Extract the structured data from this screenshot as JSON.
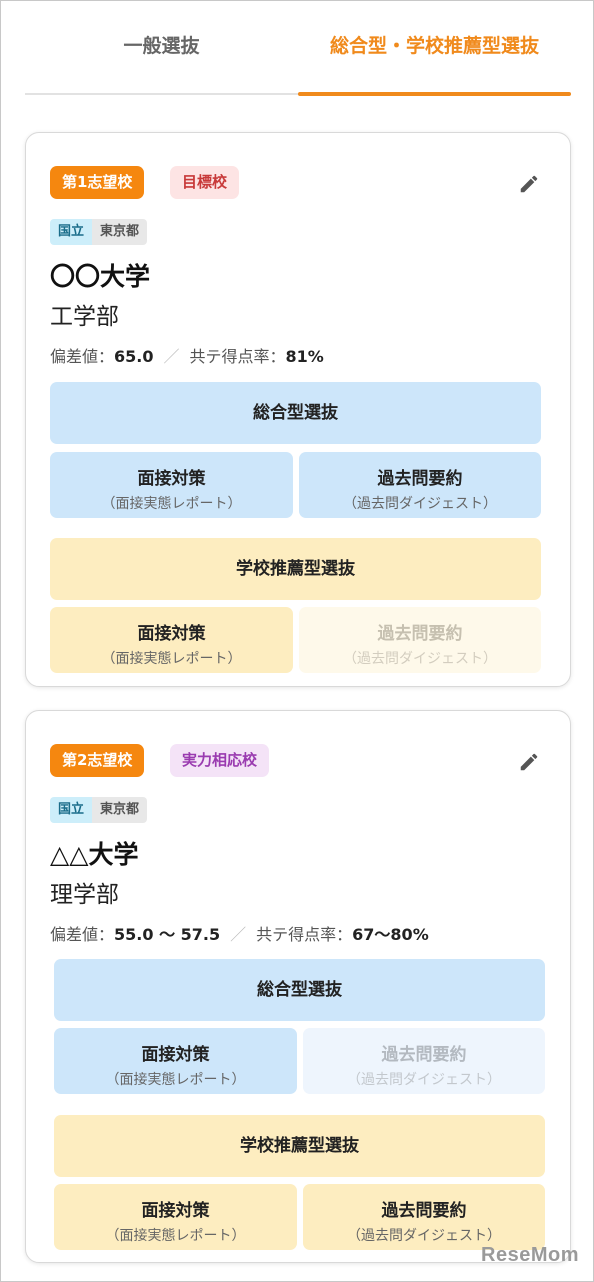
{
  "tabs": [
    {
      "label": "一般選抜",
      "active": false
    },
    {
      "label": "総合型・学校推薦型選抜",
      "active": true
    }
  ],
  "colors": {
    "accent": "#f08a1c"
  },
  "cards": [
    {
      "rank": "第1志望校",
      "category": "目標校",
      "edit_icon": "pencil-icon",
      "type": "国立",
      "location": "東京都",
      "university": "〇〇大学",
      "faculty": "工学部",
      "deviation_label": "偏差値：",
      "deviation": "65.0",
      "rate_label": "共テ得点率：",
      "rate": "81%",
      "sections": [
        {
          "title": "総合型選抜",
          "items": [
            {
              "label": "面接対策",
              "caption": "（面接実態レポート）",
              "enabled": true
            },
            {
              "label": "過去問要約",
              "caption": "（過去問ダイジェスト）",
              "enabled": true
            }
          ]
        },
        {
          "title": "学校推薦型選抜",
          "items": [
            {
              "label": "面接対策",
              "caption": "（面接実態レポート）",
              "enabled": true
            },
            {
              "label": "過去問要約",
              "caption": "（過去問ダイジェスト）",
              "enabled": false
            }
          ]
        }
      ]
    },
    {
      "rank": "第2志望校",
      "category": "実力相応校",
      "edit_icon": "pencil-icon",
      "type": "国立",
      "location": "東京都",
      "university": "△△大学",
      "faculty": "理学部",
      "deviation_label": "偏差値：",
      "deviation": "55.0 〜 57.5",
      "rate_label": "共テ得点率：",
      "rate": "67〜80%",
      "sections": [
        {
          "title": "総合型選抜",
          "items": [
            {
              "label": "面接対策",
              "caption": "（面接実態レポート）",
              "enabled": true
            },
            {
              "label": "過去問要約",
              "caption": "（過去問ダイジェスト）",
              "enabled": false
            }
          ]
        },
        {
          "title": "学校推薦型選抜",
          "items": [
            {
              "label": "面接対策",
              "caption": "（面接実態レポート）",
              "enabled": true
            },
            {
              "label": "過去問要約",
              "caption": "（過去問ダイジェスト）",
              "enabled": true
            }
          ]
        }
      ]
    }
  ],
  "watermark": "ReseMom"
}
